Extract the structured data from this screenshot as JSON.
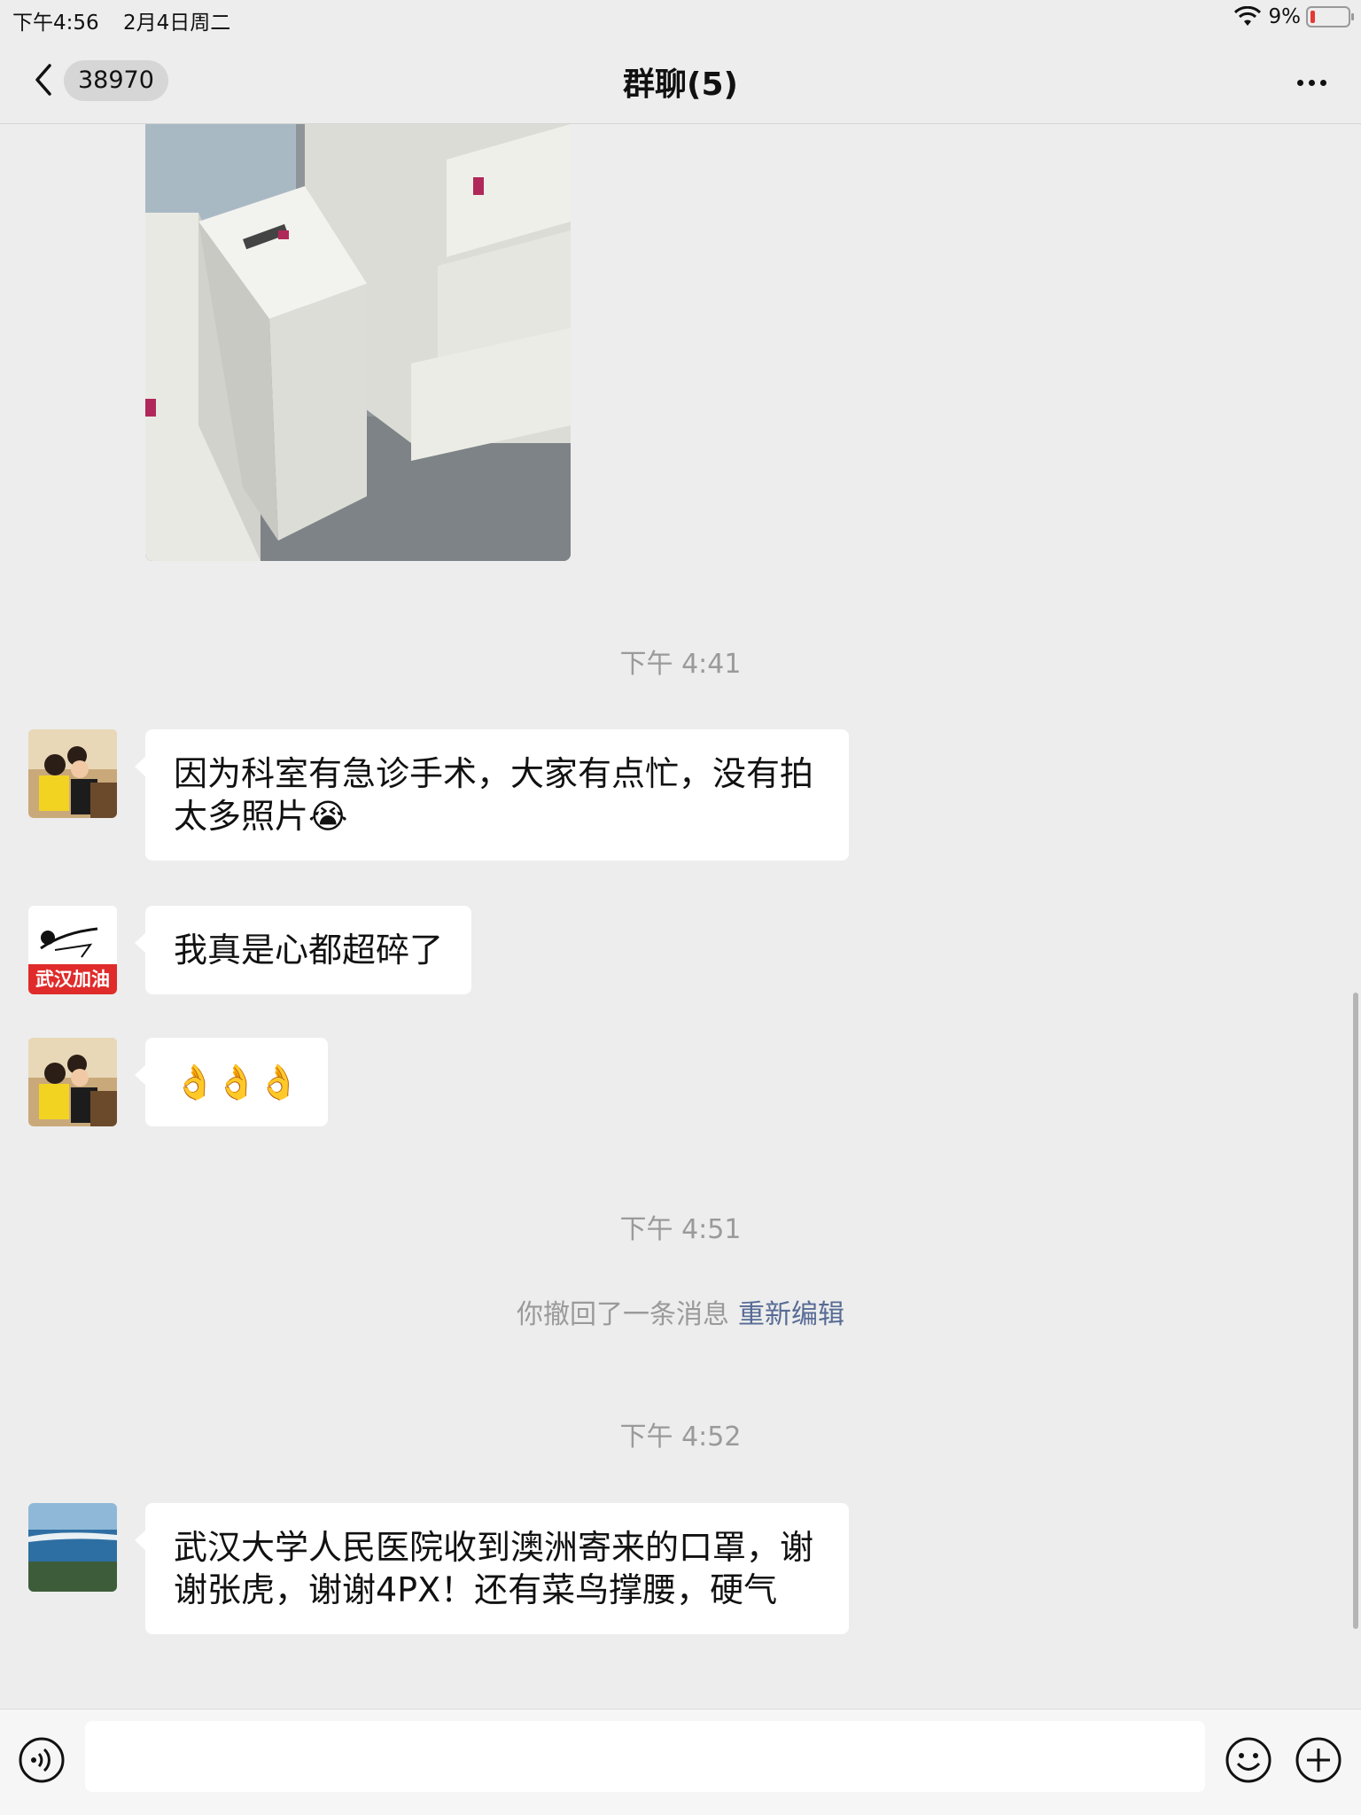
{
  "status_bar": {
    "time": "下午4:56",
    "date": "2月4日周二",
    "battery": "9%"
  },
  "nav": {
    "back_badge": "38970",
    "title": "群聊(5)"
  },
  "timestamps": {
    "t1": "下午 4:41",
    "t2": "下午 4:51",
    "t3": "下午 4:52"
  },
  "messages": [
    {
      "text": "因为科室有急诊手术，大家有点忙，没有拍太多照片😭"
    },
    {
      "text": "我真是心都超碎了"
    },
    {
      "text": "👌👌👌"
    },
    {
      "text": "武汉大学人民医院收到澳洲寄来的口罩，谢谢张虎，谢谢4PX！还有菜鸟撑腰，硬气"
    }
  ],
  "avatar_2_text": "武汉加油",
  "system_message": {
    "text": "你撤回了一条消息",
    "link": "重新编辑"
  },
  "input": {
    "placeholder": ""
  }
}
